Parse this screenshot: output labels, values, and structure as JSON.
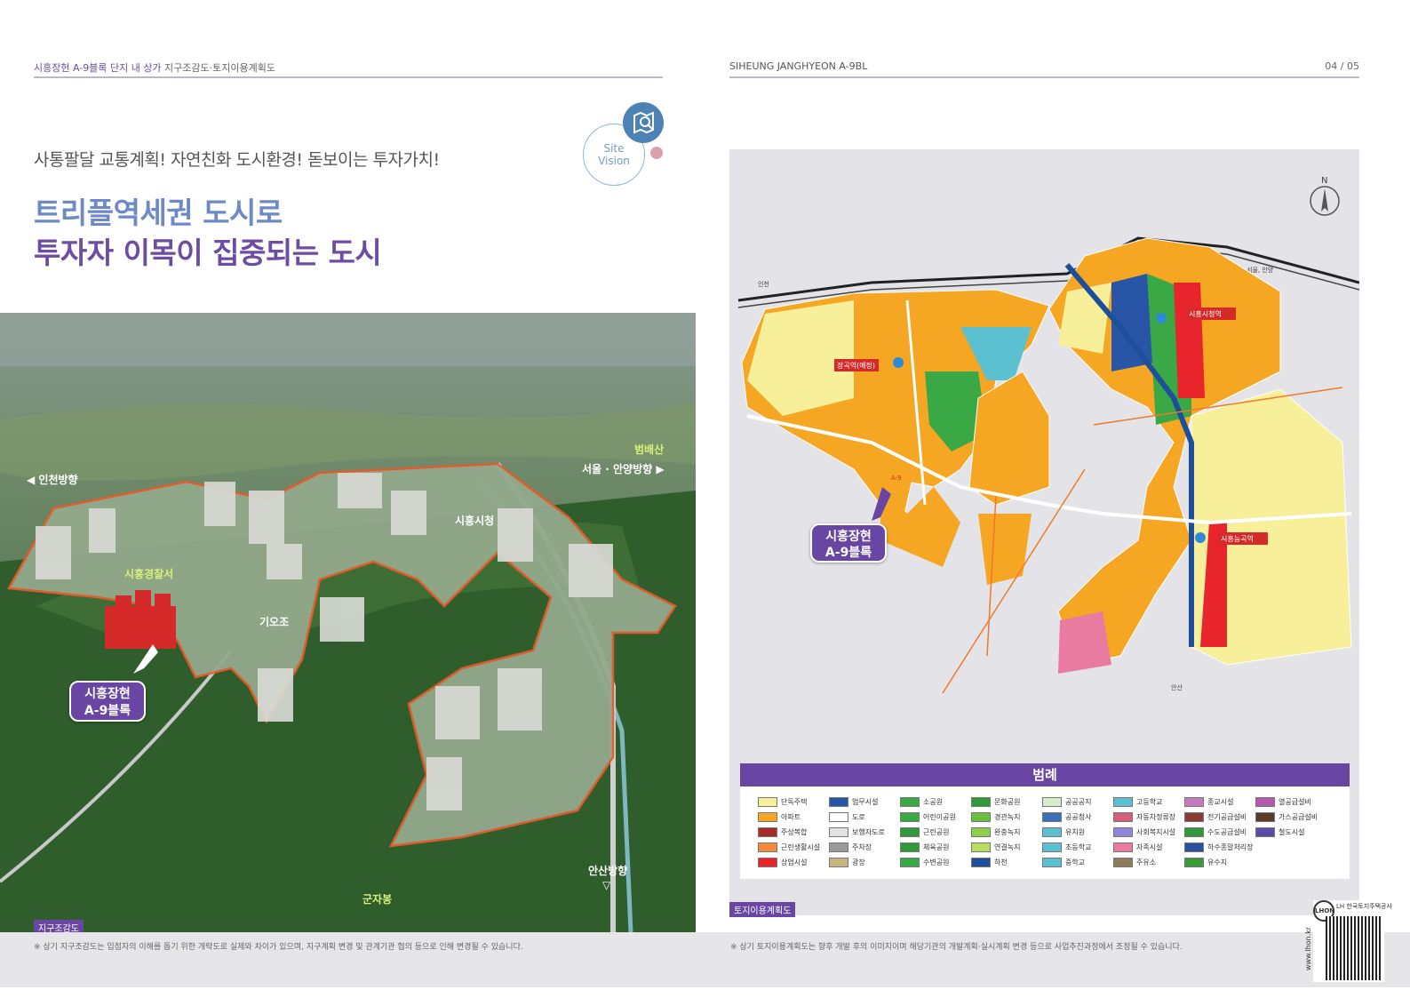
{
  "header_left": {
    "accent": "시흥장현 A-9블록 단지 내 상가",
    "rest": " 지구조감도·토지이용계획도"
  },
  "header_right": {
    "title": "SIHEUNG JANGHYEON A-9BL",
    "page": "04 / 05"
  },
  "tagline": "사통팔달 교통계획! 자연친화 도시환경! 돋보이는 투자가치!",
  "headline": {
    "line1": "트리플역세권 도시로",
    "line2": "투자자 이목이 집중되는 도시"
  },
  "vision": {
    "line1": "Site",
    "line2": "Vision",
    "icon": "map-search-icon"
  },
  "aerial": {
    "labels": {
      "incheon": "◀ 인천방향",
      "seoul": "서울 · 안양방향 ▶",
      "mountain": "범배산",
      "cityhall": "시흥시청",
      "police": "시흥경찰서",
      "ansan": "안산방향",
      "arrow_down": "▽",
      "mountain2": "군자봉",
      "small": "기오조"
    },
    "badge": {
      "line1": "시흥장현",
      "line2": "A-9블록"
    },
    "tag": "지구조감도",
    "note": "※ 상기 지구조감도는 입점자의 이해를 돕기 위한 개략도로 실제와 차이가 있으며, 지구계획 변경 및 관계기관 협의 등으로 인해 변경될 수 있습니다."
  },
  "map": {
    "north": "N",
    "dir_seoul": "서울, 안양",
    "dir_incheon": "인천",
    "dir_ansan": "안산",
    "stations": {
      "jangok": "장곡역(예정)",
      "cityhall": "시흥시청역",
      "siheung_neung": "시흥능곡역"
    },
    "block_label": "A-9",
    "badge": {
      "line1": "시흥장현",
      "line2": "A-9블록"
    },
    "tag": "토지이용계획도",
    "note": "※ 상기 토지이용계획도는 향후 개발 후의 이미지이며 해당기관의 개발계획·실시계획 변경 등으로 사업추진과정에서 조정될 수 있습니다."
  },
  "legend": {
    "title": "범례",
    "items": [
      {
        "label": "단독주택",
        "color": "#f7ef9a"
      },
      {
        "label": "아파트",
        "color": "#f5a623"
      },
      {
        "label": "주상복합",
        "color": "#a52a2a"
      },
      {
        "label": "근린생활시설",
        "color": "#f58a3c"
      },
      {
        "label": "상업시설",
        "color": "#e8242c"
      },
      {
        "label": "업무시설",
        "color": "#2855a5"
      },
      {
        "label": "도로",
        "color": "#ffffff"
      },
      {
        "label": "보행자도로",
        "color": "#e2e2e2"
      },
      {
        "label": "주차장",
        "color": "#9a9a9a"
      },
      {
        "label": "광장",
        "color": "#c9b47e"
      },
      {
        "label": "소공원",
        "color": "#3aa845"
      },
      {
        "label": "어린이공원",
        "color": "#3aa845"
      },
      {
        "label": "근린공원",
        "color": "#2f9a3c"
      },
      {
        "label": "체육공원",
        "color": "#2f9a3c"
      },
      {
        "label": "수변공원",
        "color": "#3aa845"
      },
      {
        "label": "문화공원",
        "color": "#2f9a3c"
      },
      {
        "label": "경관녹지",
        "color": "#6abf3e"
      },
      {
        "label": "완충녹지",
        "color": "#8ccf4c"
      },
      {
        "label": "연결녹지",
        "color": "#b7dc62"
      },
      {
        "label": "하천",
        "color": "#1e4f9a"
      },
      {
        "label": "공공공지",
        "color": "#d6eccb"
      },
      {
        "label": "공공청사",
        "color": "#3b6fb8"
      },
      {
        "label": "유치원",
        "color": "#5bc0d0"
      },
      {
        "label": "초등학교",
        "color": "#5bc0d0"
      },
      {
        "label": "중학교",
        "color": "#5bc0d0"
      },
      {
        "label": "고등학교",
        "color": "#5bc0d0"
      },
      {
        "label": "자동차정류장",
        "color": "#d0607e"
      },
      {
        "label": "사회복지시설",
        "color": "#8e86d8"
      },
      {
        "label": "자족시설",
        "color": "#e97aa0"
      },
      {
        "label": "주유소",
        "color": "#8b7c5a"
      },
      {
        "label": "종교시설",
        "color": "#c47ac0"
      },
      {
        "label": "전기공급설비",
        "color": "#8b3a3a"
      },
      {
        "label": "수도공급설비",
        "color": "#2e9a3a"
      },
      {
        "label": "하수종말처리장",
        "color": "#2c4fa0"
      },
      {
        "label": "유수지",
        "color": "#3a9a3a"
      },
      {
        "label": "열공급설비",
        "color": "#b35bb0"
      },
      {
        "label": "가스공급설비",
        "color": "#5a3a2a"
      },
      {
        "label": "철도시설",
        "color": "#5b4aa8"
      }
    ]
  },
  "qr": {
    "site": "www.lhon.kr",
    "caption": "LH 한국토지주택공사",
    "logo": "LHON"
  }
}
